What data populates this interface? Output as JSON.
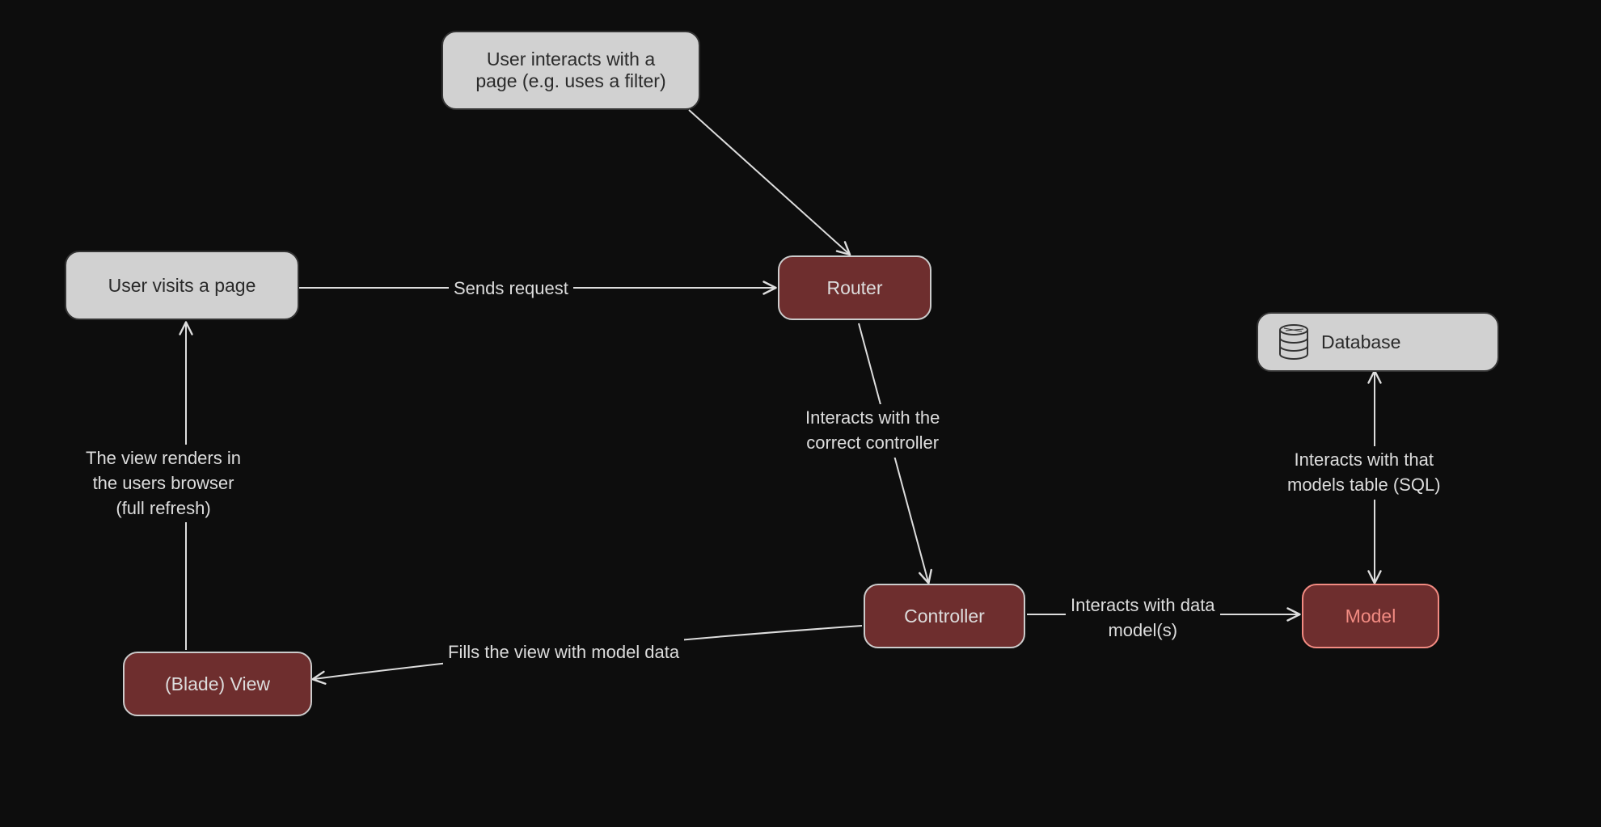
{
  "nodes": {
    "user_visits": {
      "label": "User visits a page"
    },
    "user_interacts": {
      "label": "User interacts with a\npage (e.g. uses a filter)"
    },
    "router": {
      "label": "Router"
    },
    "controller": {
      "label": "Controller"
    },
    "view": {
      "label": "(Blade) View"
    },
    "model": {
      "label": "Model"
    },
    "database": {
      "label": "Database"
    }
  },
  "edges": {
    "visits_to_router": "Sends request",
    "interacts_to_router": "",
    "router_to_controller": "Interacts with the\ncorrect controller",
    "controller_to_model": "Interacts with data\nmodel(s)",
    "model_to_db": "Interacts with that\nmodels table (SQL)",
    "controller_to_view": "Fills the view with model data",
    "view_to_visits": "The view renders in\nthe users browser\n(full refresh)"
  },
  "colors": {
    "bg": "#0d0d0d",
    "light_bg": "#d1d1d1",
    "dark_box": "#6e2e2e",
    "model_accent": "#f28b82",
    "stroke": "#dddddd"
  }
}
